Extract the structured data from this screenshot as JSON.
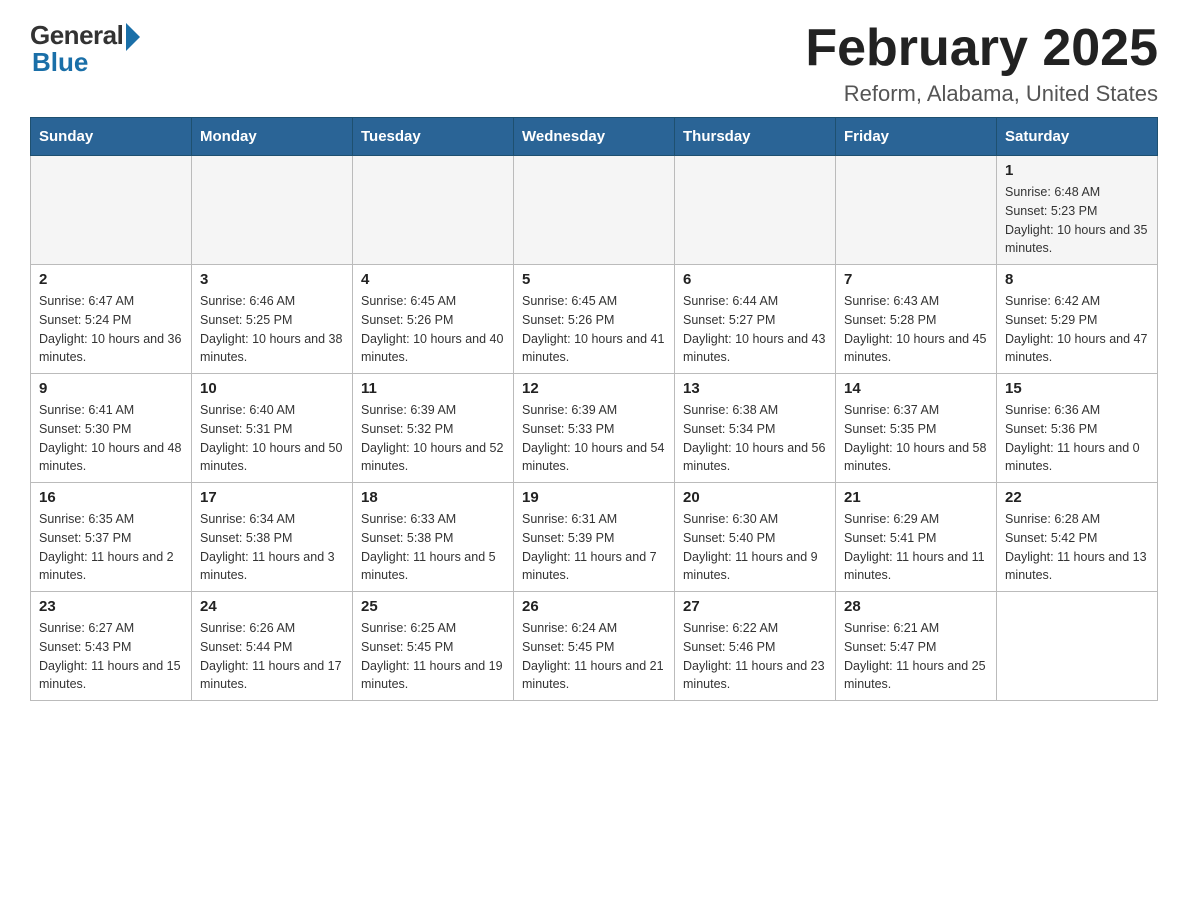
{
  "header": {
    "logo_general": "General",
    "logo_blue": "Blue",
    "main_title": "February 2025",
    "subtitle": "Reform, Alabama, United States"
  },
  "calendar": {
    "days_of_week": [
      "Sunday",
      "Monday",
      "Tuesday",
      "Wednesday",
      "Thursday",
      "Friday",
      "Saturday"
    ],
    "weeks": [
      {
        "days": [
          {
            "num": "",
            "info": ""
          },
          {
            "num": "",
            "info": ""
          },
          {
            "num": "",
            "info": ""
          },
          {
            "num": "",
            "info": ""
          },
          {
            "num": "",
            "info": ""
          },
          {
            "num": "",
            "info": ""
          },
          {
            "num": "1",
            "info": "Sunrise: 6:48 AM\nSunset: 5:23 PM\nDaylight: 10 hours and 35 minutes."
          }
        ]
      },
      {
        "days": [
          {
            "num": "2",
            "info": "Sunrise: 6:47 AM\nSunset: 5:24 PM\nDaylight: 10 hours and 36 minutes."
          },
          {
            "num": "3",
            "info": "Sunrise: 6:46 AM\nSunset: 5:25 PM\nDaylight: 10 hours and 38 minutes."
          },
          {
            "num": "4",
            "info": "Sunrise: 6:45 AM\nSunset: 5:26 PM\nDaylight: 10 hours and 40 minutes."
          },
          {
            "num": "5",
            "info": "Sunrise: 6:45 AM\nSunset: 5:26 PM\nDaylight: 10 hours and 41 minutes."
          },
          {
            "num": "6",
            "info": "Sunrise: 6:44 AM\nSunset: 5:27 PM\nDaylight: 10 hours and 43 minutes."
          },
          {
            "num": "7",
            "info": "Sunrise: 6:43 AM\nSunset: 5:28 PM\nDaylight: 10 hours and 45 minutes."
          },
          {
            "num": "8",
            "info": "Sunrise: 6:42 AM\nSunset: 5:29 PM\nDaylight: 10 hours and 47 minutes."
          }
        ]
      },
      {
        "days": [
          {
            "num": "9",
            "info": "Sunrise: 6:41 AM\nSunset: 5:30 PM\nDaylight: 10 hours and 48 minutes."
          },
          {
            "num": "10",
            "info": "Sunrise: 6:40 AM\nSunset: 5:31 PM\nDaylight: 10 hours and 50 minutes."
          },
          {
            "num": "11",
            "info": "Sunrise: 6:39 AM\nSunset: 5:32 PM\nDaylight: 10 hours and 52 minutes."
          },
          {
            "num": "12",
            "info": "Sunrise: 6:39 AM\nSunset: 5:33 PM\nDaylight: 10 hours and 54 minutes."
          },
          {
            "num": "13",
            "info": "Sunrise: 6:38 AM\nSunset: 5:34 PM\nDaylight: 10 hours and 56 minutes."
          },
          {
            "num": "14",
            "info": "Sunrise: 6:37 AM\nSunset: 5:35 PM\nDaylight: 10 hours and 58 minutes."
          },
          {
            "num": "15",
            "info": "Sunrise: 6:36 AM\nSunset: 5:36 PM\nDaylight: 11 hours and 0 minutes."
          }
        ]
      },
      {
        "days": [
          {
            "num": "16",
            "info": "Sunrise: 6:35 AM\nSunset: 5:37 PM\nDaylight: 11 hours and 2 minutes."
          },
          {
            "num": "17",
            "info": "Sunrise: 6:34 AM\nSunset: 5:38 PM\nDaylight: 11 hours and 3 minutes."
          },
          {
            "num": "18",
            "info": "Sunrise: 6:33 AM\nSunset: 5:38 PM\nDaylight: 11 hours and 5 minutes."
          },
          {
            "num": "19",
            "info": "Sunrise: 6:31 AM\nSunset: 5:39 PM\nDaylight: 11 hours and 7 minutes."
          },
          {
            "num": "20",
            "info": "Sunrise: 6:30 AM\nSunset: 5:40 PM\nDaylight: 11 hours and 9 minutes."
          },
          {
            "num": "21",
            "info": "Sunrise: 6:29 AM\nSunset: 5:41 PM\nDaylight: 11 hours and 11 minutes."
          },
          {
            "num": "22",
            "info": "Sunrise: 6:28 AM\nSunset: 5:42 PM\nDaylight: 11 hours and 13 minutes."
          }
        ]
      },
      {
        "days": [
          {
            "num": "23",
            "info": "Sunrise: 6:27 AM\nSunset: 5:43 PM\nDaylight: 11 hours and 15 minutes."
          },
          {
            "num": "24",
            "info": "Sunrise: 6:26 AM\nSunset: 5:44 PM\nDaylight: 11 hours and 17 minutes."
          },
          {
            "num": "25",
            "info": "Sunrise: 6:25 AM\nSunset: 5:45 PM\nDaylight: 11 hours and 19 minutes."
          },
          {
            "num": "26",
            "info": "Sunrise: 6:24 AM\nSunset: 5:45 PM\nDaylight: 11 hours and 21 minutes."
          },
          {
            "num": "27",
            "info": "Sunrise: 6:22 AM\nSunset: 5:46 PM\nDaylight: 11 hours and 23 minutes."
          },
          {
            "num": "28",
            "info": "Sunrise: 6:21 AM\nSunset: 5:47 PM\nDaylight: 11 hours and 25 minutes."
          },
          {
            "num": "",
            "info": ""
          }
        ]
      }
    ]
  }
}
